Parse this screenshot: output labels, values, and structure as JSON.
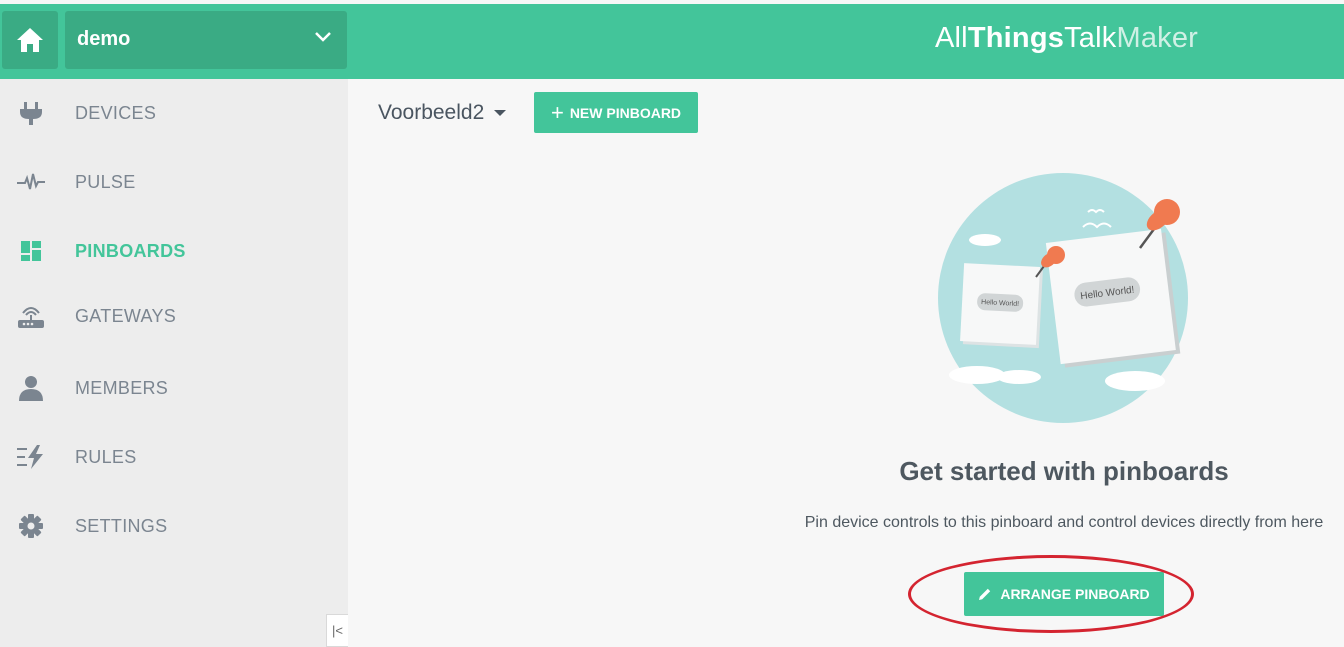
{
  "header": {
    "workspace": "demo",
    "brand_parts": [
      "All",
      "Things",
      "Talk",
      "Maker"
    ]
  },
  "sidebar": {
    "items": [
      {
        "label": "DEVICES",
        "icon": "plug-icon"
      },
      {
        "label": "PULSE",
        "icon": "pulse-icon"
      },
      {
        "label": "PINBOARDS",
        "icon": "dashboard-icon",
        "active": true
      },
      {
        "label": "GATEWAYS",
        "icon": "router-icon"
      },
      {
        "label": "MEMBERS",
        "icon": "user-icon"
      },
      {
        "label": "RULES",
        "icon": "lightning-icon"
      },
      {
        "label": "SETTINGS",
        "icon": "gear-icon"
      }
    ],
    "collapse_label": "|<"
  },
  "main": {
    "board_name": "Voorbeeld2",
    "new_button": "NEW PINBOARD",
    "empty_title": "Get started with pinboards",
    "empty_desc": "Pin device controls to this pinboard and control devices directly from here",
    "arrange_button": "ARRANGE PINBOARD",
    "illustration": {
      "bubble_small": "Hello World!",
      "bubble_large": "Hello World!"
    }
  },
  "colors": {
    "accent": "#43c59a",
    "accent_dark": "#3aab84",
    "highlight": "#d42430"
  }
}
